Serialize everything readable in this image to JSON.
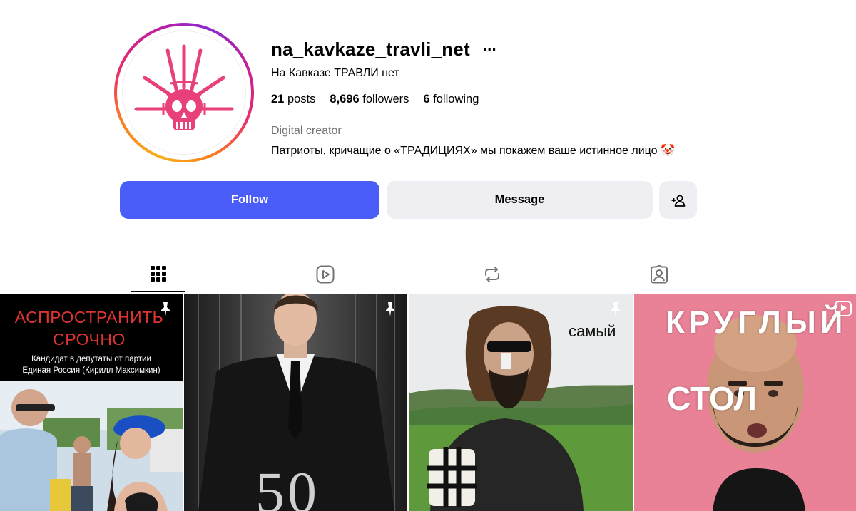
{
  "profile": {
    "username": "na_kavkaze_travli_net",
    "more_icon": "more-horizontal-icon",
    "full_name": "На Кавказе ТРАВЛИ нет",
    "stats": {
      "posts_count": "21",
      "posts_label": "posts",
      "followers_count": "8,696",
      "followers_label": "followers",
      "following_count": "6",
      "following_label": "following"
    },
    "category": "Digital creator",
    "bio": "Патриоты, кричащие о «ТРАДИЦИЯХ» мы покажем ваше истинное лицо 🤡",
    "avatar_icon": "skull-with-daggers-logo"
  },
  "actions": {
    "follow_label": "Follow",
    "message_label": "Message",
    "suggest_icon": "add-person-icon"
  },
  "tabs": [
    {
      "name": "posts",
      "icon": "grid-icon",
      "active": true
    },
    {
      "name": "reels",
      "icon": "reels-icon",
      "active": false
    },
    {
      "name": "reposts",
      "icon": "repost-icon",
      "active": false
    },
    {
      "name": "tagged",
      "icon": "tagged-icon",
      "active": false
    }
  ],
  "posts": [
    {
      "pinned": true,
      "headline": "АСПРОСТРАНИТЬ СРОЧНО",
      "subtext_line1": "Кандидат в депутаты от партии",
      "subtext_line2": "Единая Россия (Кирилл Максимкин)"
    },
    {
      "pinned": true,
      "overlay_text": "50"
    },
    {
      "pinned": true,
      "overlay_text": "самый"
    },
    {
      "pinned": false,
      "title": "КРУГЛЫЙ",
      "side_text": "СТОЛ",
      "reel_icon": "reel-play-icon"
    }
  ],
  "colors": {
    "follow_button": "#4a5df9",
    "secondary_button": "#efeff3",
    "muted_text": "#737373",
    "logo_pink": "#e8407a"
  }
}
